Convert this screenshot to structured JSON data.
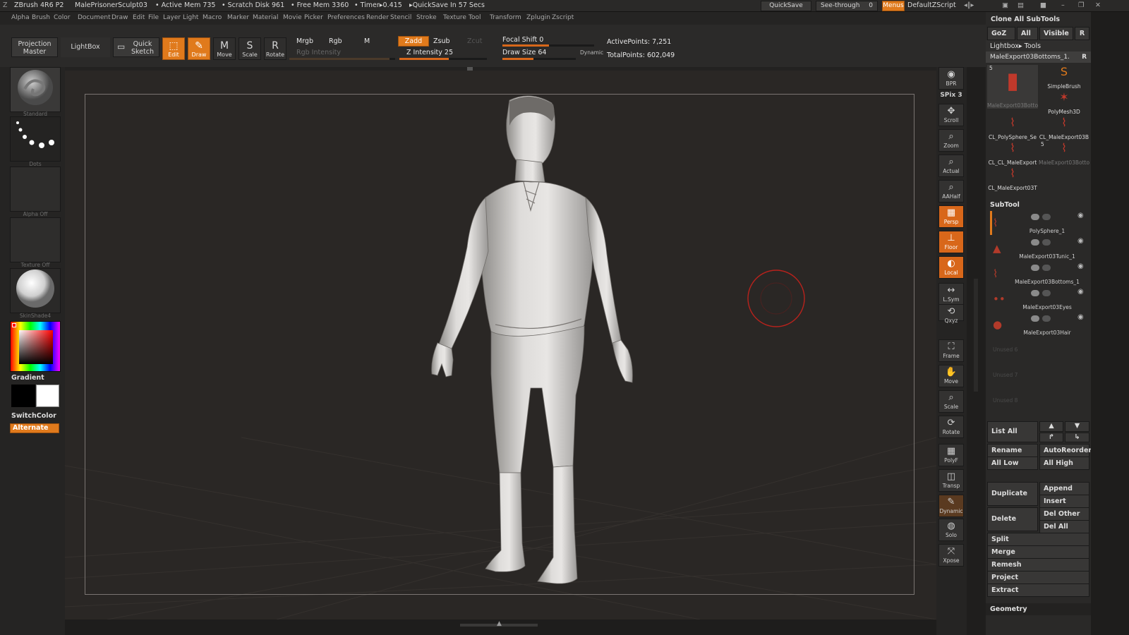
{
  "title_bar": {
    "app": "ZBrush 4R6 P2",
    "document": "MalePrisonerSculpt03",
    "active_mem": "• Active Mem 735",
    "scratch_disk": "• Scratch Disk 961",
    "free_mem": "• Free Mem 3360",
    "timer": "• Timer▸0.415",
    "quicksave_status": "▸QuickSave In 57 Secs",
    "quicksave_btn": "QuickSave",
    "see_through": "See-through",
    "see_through_value": "0",
    "menus_btn": "Menus",
    "default_script": "DefaultZScript"
  },
  "menu_bar": [
    "Alpha",
    "Brush",
    "Color",
    "Document",
    "Draw",
    "Edit",
    "File",
    "Layer",
    "Light",
    "Macro",
    "Marker",
    "Material",
    "Movie",
    "Picker",
    "Preferences",
    "Render",
    "Stencil",
    "Stroke",
    "Texture",
    "Tool",
    "Transform",
    "Zplugin",
    "Zscript"
  ],
  "toolbar": {
    "projection_master": "Projection Master",
    "lightbox": "LightBox",
    "quick_sketch": "Quick Sketch",
    "edit": "Edit",
    "draw": "Draw",
    "move": "Move",
    "scale": "Scale",
    "rotate": "Rotate",
    "mrgb": "Mrgb",
    "rgb": "Rgb",
    "m": "M",
    "rgb_intensity": "Rgb Intensity",
    "zadd": "Zadd",
    "zsub": "Zsub",
    "zcut": "Zcut",
    "z_intensity_label": "Z Intensity 25",
    "focal_shift_label": "Focal Shift 0",
    "draw_size_label": "Draw Size 64",
    "dynamic": "Dynamic",
    "active_points": "ActivePoints: 7,251",
    "total_points": "TotalPoints: 602,049"
  },
  "left_panel": {
    "brush": "Standard",
    "stroke": "Dots",
    "alpha": "Alpha Off",
    "texture": "Texture Off",
    "material": "SkinShade4",
    "gradient": "Gradient",
    "switch_color": "SwitchColor",
    "alternate": "Alternate"
  },
  "right_shelf": [
    {
      "name": "bpr",
      "label": "BPR"
    },
    {
      "name": "spix",
      "label": "SPix 3"
    },
    {
      "name": "scroll",
      "label": "Scroll"
    },
    {
      "name": "zoom",
      "label": "Zoom"
    },
    {
      "name": "actual",
      "label": "Actual"
    },
    {
      "name": "aahalf",
      "label": "AAHalf"
    },
    {
      "name": "persp",
      "label": "Persp"
    },
    {
      "name": "floor",
      "label": "Floor"
    },
    {
      "name": "local",
      "label": "Local"
    },
    {
      "name": "lsym",
      "label": "L.Sym"
    },
    {
      "name": "xyz",
      "label": "Qxyz"
    },
    {
      "name": "frame",
      "label": "Frame"
    },
    {
      "name": "move",
      "label": "Move"
    },
    {
      "name": "scale",
      "label": "Scale"
    },
    {
      "name": "rotate",
      "label": "Rotate"
    },
    {
      "name": "polyf",
      "label": "PolyF"
    },
    {
      "name": "transp",
      "label": "Transp"
    },
    {
      "name": "dynamic",
      "label": "Dynamic"
    },
    {
      "name": "solo",
      "label": "Solo"
    },
    {
      "name": "xpose",
      "label": "Xpose"
    }
  ],
  "tool_palette": {
    "clone": "Clone  All SubTools",
    "goz": "GoZ",
    "all": "All",
    "visible": "Visible",
    "r": "R",
    "lightbox_tools": "Lightbox▸ Tools",
    "current_tool": "MaleExport03Bottoms_1.",
    "current_tool_count": "5",
    "tools": [
      "MaleExport03Botto",
      "SimpleBrush",
      "PolyMesh3D",
      "CL_PolySphere_Se",
      "CL_MaleExport03B",
      "CL_CL_MaleExport",
      "MaleExport03Botto",
      "CL_MaleExport03T"
    ],
    "tool_counts": [
      "5",
      "",
      "",
      "",
      "",
      "",
      "5",
      ""
    ]
  },
  "subtool": {
    "header": "SubTool",
    "items": [
      "PolySphere_1",
      "MaleExport03Tunic_1",
      "MaleExport03Bottoms_1",
      "MaleExport03Eyes",
      "MaleExport03Hair",
      "Unused 6",
      "Unused 7",
      "Unused 8"
    ],
    "list_all": "List All",
    "rename": "Rename",
    "auto_reorder": "AutoReorder",
    "all_low": "All Low",
    "all_high": "All High",
    "duplicate": "Duplicate",
    "append": "Append",
    "insert": "Insert",
    "delete": "Delete",
    "del_other": "Del Other",
    "del_all": "Del All",
    "split": "Split",
    "merge": "Merge",
    "remesh": "Remesh",
    "project": "Project",
    "extract": "Extract",
    "geometry": "Geometry"
  },
  "colors": {
    "accent": "#e07a1c",
    "panel": "#2a2928",
    "viewport": "#2a2725"
  }
}
